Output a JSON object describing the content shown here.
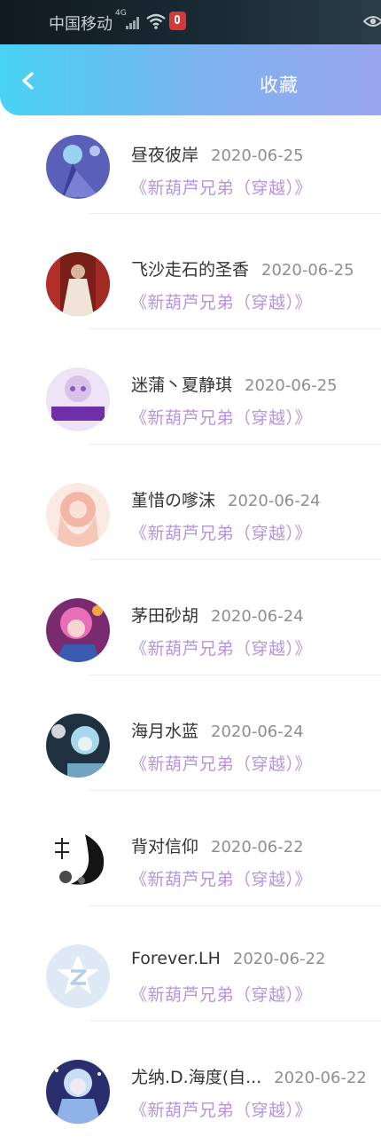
{
  "status_bar": {
    "carrier": "中国移动",
    "network": "4G"
  },
  "header": {
    "title": "收藏"
  },
  "favorites": [
    {
      "name": "昼夜彼岸",
      "date": "2020-06-25",
      "book": "《新葫芦兄弟（穿越）》"
    },
    {
      "name": "飞沙走石的圣香",
      "date": "2020-06-25",
      "book": "《新葫芦兄弟（穿越）》"
    },
    {
      "name": "迷蒲丶夏静琪",
      "date": "2020-06-25",
      "book": "《新葫芦兄弟（穿越）》"
    },
    {
      "name": "堇惜の嗲沫",
      "date": "2020-06-24",
      "book": "《新葫芦兄弟（穿越）》"
    },
    {
      "name": "茅田砂胡",
      "date": "2020-06-24",
      "book": "《新葫芦兄弟（穿越）》"
    },
    {
      "name": "海月水蓝",
      "date": "2020-06-24",
      "book": "《新葫芦兄弟（穿越）》"
    },
    {
      "name": "背对信仰",
      "date": "2020-06-22",
      "book": "《新葫芦兄弟（穿越）》"
    },
    {
      "name": "Forever.LH",
      "date": "2020-06-22",
      "book": "《新葫芦兄弟（穿越）》"
    },
    {
      "name": "尤纳.D.海度(自...",
      "date": "2020-06-22",
      "book": "《新葫芦兄弟（穿越）》"
    }
  ],
  "colors": {
    "header_gradient_start": "#47d2f3",
    "header_gradient_end": "#9aa6ef",
    "book_title": "#b794e0",
    "date_text": "#8e8e8e"
  },
  "icons": {
    "back": "chevron-left-icon",
    "wifi": "wifi-icon",
    "mic": "microphone-icon",
    "eye": "eye-icon",
    "default_avatar": "star-z-icon"
  }
}
